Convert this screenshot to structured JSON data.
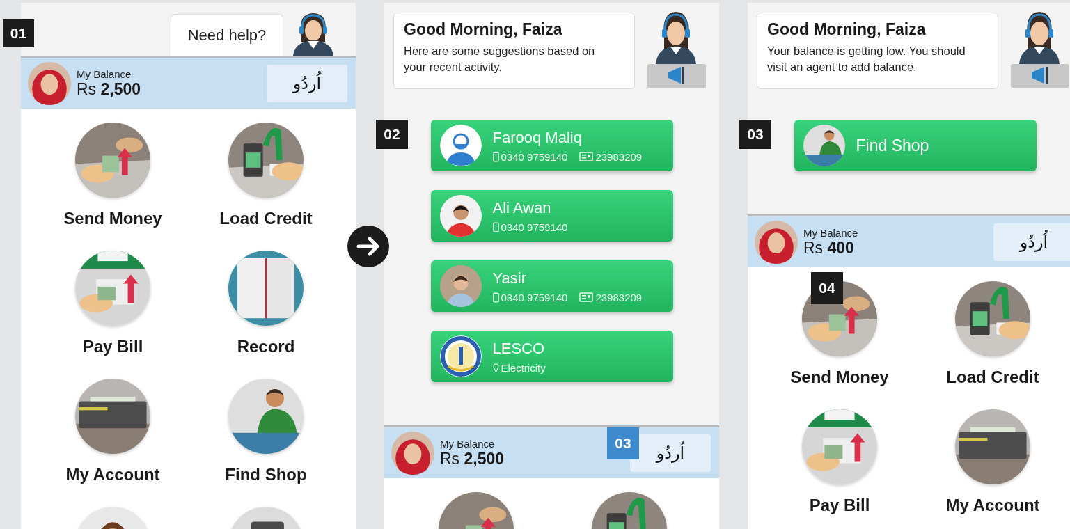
{
  "screens": [
    {
      "step": {
        "text": "01",
        "color": "#1c1c1c"
      },
      "help": "Need help?",
      "balance": {
        "label": "My Balance",
        "currency": "Rs",
        "amount": "2,500",
        "language": "اُردُو"
      },
      "tiles": [
        {
          "label": "Send Money",
          "kind": "send"
        },
        {
          "label": "Load Credit",
          "kind": "load"
        },
        {
          "label": "Pay Bill",
          "kind": "bill"
        },
        {
          "label": "Record",
          "kind": "record"
        },
        {
          "label": "My Account",
          "kind": "account"
        },
        {
          "label": "Find Shop",
          "kind": "shop"
        },
        {
          "kind": "person"
        },
        {
          "kind": "device"
        }
      ]
    },
    {
      "step": {
        "text": "02",
        "color": "#1c1c1c"
      },
      "greeting": {
        "title": "Good Morning, Faiza",
        "message": "Here are some suggestions based on your recent activity."
      },
      "suggestions": [
        {
          "name": "Farooq Maliq",
          "kind": "generic",
          "phone": "0340 9759140",
          "id": "23983209"
        },
        {
          "name": "Ali Awan",
          "phone": "0340 9759140"
        },
        {
          "name": "Yasir",
          "phone": "0340 9759140",
          "id": "23983209"
        },
        {
          "name": "LESCO",
          "kind": "emblem",
          "category": "Electricity"
        }
      ],
      "balance": {
        "label": "My Balance",
        "currency": "Rs",
        "amount": "2,500",
        "language": "اُردُو",
        "badge": {
          "text": "03",
          "color": "#3d8bcd"
        }
      },
      "tiles": [
        {
          "kind": "send"
        },
        {
          "kind": "load"
        }
      ]
    },
    {
      "step": {
        "text": "03",
        "color": "#1c1c1c"
      },
      "greeting": {
        "title": "Good Morning, Faiza",
        "message": "Your balance is getting low. You should visit an agent to add balance."
      },
      "suggestions": [
        {
          "name": "Find Shop",
          "kind": "shop"
        }
      ],
      "balance": {
        "label": "My Balance",
        "currency": "Rs",
        "amount": "400",
        "language": "اُردُو"
      },
      "tiles": [
        {
          "label": "Send Money",
          "kind": "send",
          "badge": {
            "text": "04",
            "color": "#1c1c1c"
          }
        },
        {
          "label": "Load Credit",
          "kind": "load"
        },
        {
          "label": "Pay Bill",
          "kind": "bill"
        },
        {
          "label": "My Account",
          "kind": "account"
        }
      ]
    }
  ]
}
